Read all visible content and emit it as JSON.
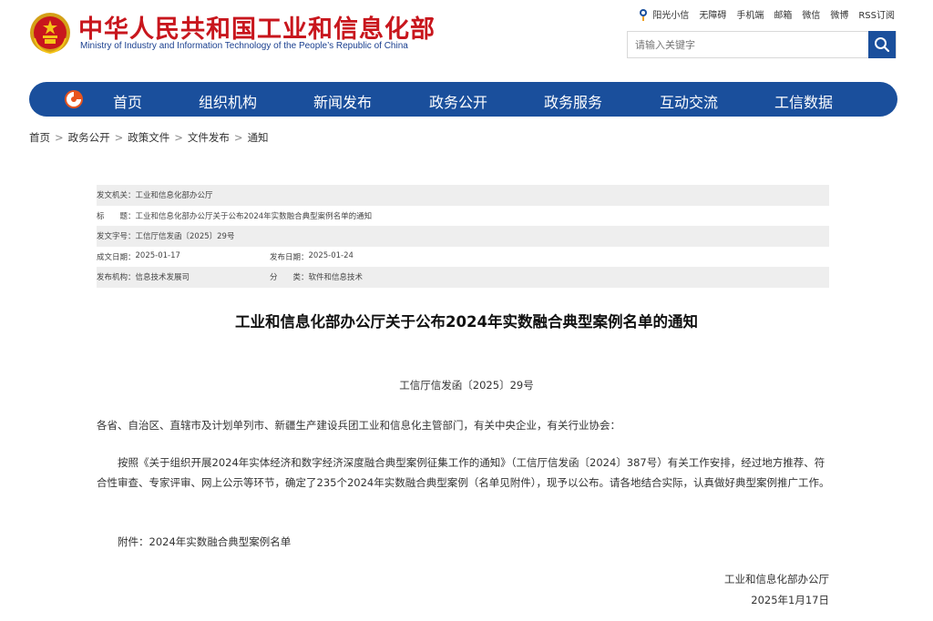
{
  "header": {
    "site_name_cn": "中华人民共和国工业和信息化部",
    "site_name_en": "Ministry of Industry and Information Technology of the People’s Republic of China",
    "top_links": [
      "阳光小信",
      "无障碍",
      "手机端",
      "邮箱",
      "微信",
      "微博",
      "RSS订阅"
    ],
    "search_placeholder": "请输入关键字"
  },
  "nav": {
    "items": [
      "首页",
      "组织机构",
      "新闻发布",
      "政务公开",
      "政务服务",
      "互动交流",
      "工信数据"
    ]
  },
  "breadcrumb": [
    "首页",
    "政务公开",
    "政策文件",
    "文件发布",
    "通知"
  ],
  "info": {
    "issuer_label": "发文机关：",
    "issuer": "工业和信息化部办公厅",
    "title_label": "标　　题：",
    "title": "工业和信息化部办公厅关于公布2024年实数融合典型案例名单的通知",
    "docno_label": "发文字号：",
    "docno": "工信厅信发函〔2025〕29号",
    "created_label": "成文日期：",
    "created": "2025-01-17",
    "published_label": "发布日期：",
    "published": "2025-01-24",
    "org_label": "发布机构：",
    "org": "信息技术发展司",
    "category_label": "分　　类：",
    "category": "软件和信息技术"
  },
  "article": {
    "title": "工业和信息化部办公厅关于公布2024年实数融合典型案例名单的通知",
    "docno": "工信厅信发函〔2025〕29号",
    "salutation": "各省、自治区、直辖市及计划单列市、新疆生产建设兵团工业和信息化主管部门，有关中央企业，有关行业协会：",
    "body": "按照《关于组织开展2024年实体经济和数字经济深度融合典型案例征集工作的通知》（工信厅信发函〔2024〕387号）有关工作安排，经过地方推荐、符合性审查、专家评审、网上公示等环节，确定了235个2024年实数融合典型案例（名单见附件），现予以公布。请各地结合实际，认真做好典型案例推广工作。",
    "attachment": "附件：2024年实数融合典型案例名单",
    "signature": "工业和信息化部办公厅",
    "date": "2025年1月17日"
  },
  "colors": {
    "brand_red": "#c8161d",
    "nav_blue": "#1a4f9c",
    "table_shade": "#eeeeee"
  }
}
